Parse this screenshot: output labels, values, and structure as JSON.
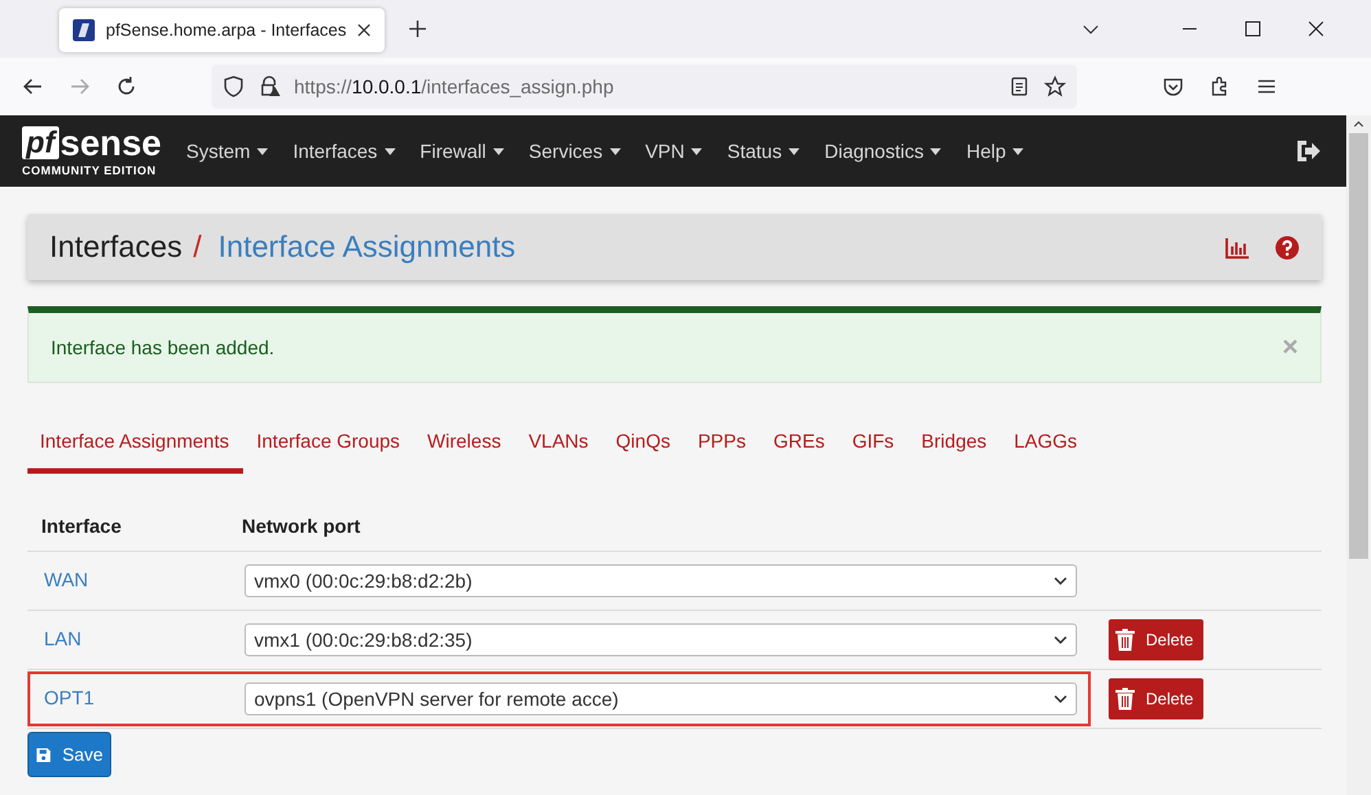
{
  "browser": {
    "tab_title": "pfSense.home.arpa - Interfaces",
    "url_scheme": "https://",
    "url_host": "10.0.0.1",
    "url_path": "/interfaces_assign.php"
  },
  "brand": {
    "mark": "pf",
    "word": "sense",
    "edition": "COMMUNITY EDITION"
  },
  "nav": [
    "System",
    "Interfaces",
    "Firewall",
    "Services",
    "VPN",
    "Status",
    "Diagnostics",
    "Help"
  ],
  "breadcrumb": {
    "parent": "Interfaces",
    "separator": "/",
    "current": "Interface Assignments"
  },
  "alert": {
    "message": "Interface has been added.",
    "close": "×"
  },
  "tabs": [
    {
      "label": "Interface Assignments",
      "selected": true
    },
    {
      "label": "Interface Groups",
      "selected": false
    },
    {
      "label": "Wireless",
      "selected": false
    },
    {
      "label": "VLANs",
      "selected": false
    },
    {
      "label": "QinQs",
      "selected": false
    },
    {
      "label": "PPPs",
      "selected": false
    },
    {
      "label": "GREs",
      "selected": false
    },
    {
      "label": "GIFs",
      "selected": false
    },
    {
      "label": "Bridges",
      "selected": false
    },
    {
      "label": "LAGGs",
      "selected": false
    }
  ],
  "table": {
    "columns": [
      "Interface",
      "Network port"
    ],
    "rows": [
      {
        "interface": "WAN",
        "port": "vmx0 (00:0c:29:b8:d2:2b)",
        "highlighted": false
      },
      {
        "interface": "LAN",
        "port": "vmx1 (00:0c:29:b8:d2:35)",
        "delete": "Delete",
        "highlighted": false
      },
      {
        "interface": "OPT1",
        "port": "ovpns1 (OpenVPN server for remote acce)",
        "delete": "Delete",
        "highlighted": true
      }
    ]
  },
  "save": "Save"
}
